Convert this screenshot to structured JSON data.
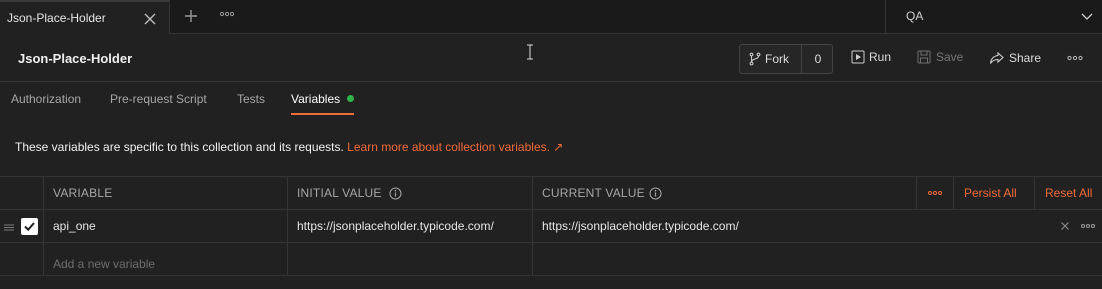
{
  "tabbar": {
    "active_tab_label": "Json-Place-Holder",
    "environment": "QA"
  },
  "header": {
    "title": "Json-Place-Holder",
    "fork_label": "Fork",
    "fork_count": "0",
    "run_label": "Run",
    "save_label": "Save",
    "share_label": "Share"
  },
  "subtabs": {
    "items": [
      {
        "label": "Authorization"
      },
      {
        "label": "Pre-request Script"
      },
      {
        "label": "Tests"
      },
      {
        "label": "Variables"
      }
    ],
    "active": "Variables",
    "status_dot_color": "#2fb34a"
  },
  "info": {
    "text": "These variables are specific to this collection and its requests.",
    "link": "Learn more about collection variables. ↗"
  },
  "table": {
    "headers": {
      "variable": "VARIABLE",
      "initial_value": "INITIAL VALUE",
      "current_value": "CURRENT VALUE",
      "persist_all": "Persist All",
      "reset_all": "Reset All"
    },
    "rows": [
      {
        "enabled": true,
        "variable": "api_one",
        "initial_value": "https://jsonplaceholder.typicode.com/",
        "current_value": "https://jsonplaceholder.typicode.com/"
      }
    ],
    "new_variable_placeholder": "Add a new variable"
  },
  "colors": {
    "accent": "#f26b3a",
    "background": "#212121"
  }
}
